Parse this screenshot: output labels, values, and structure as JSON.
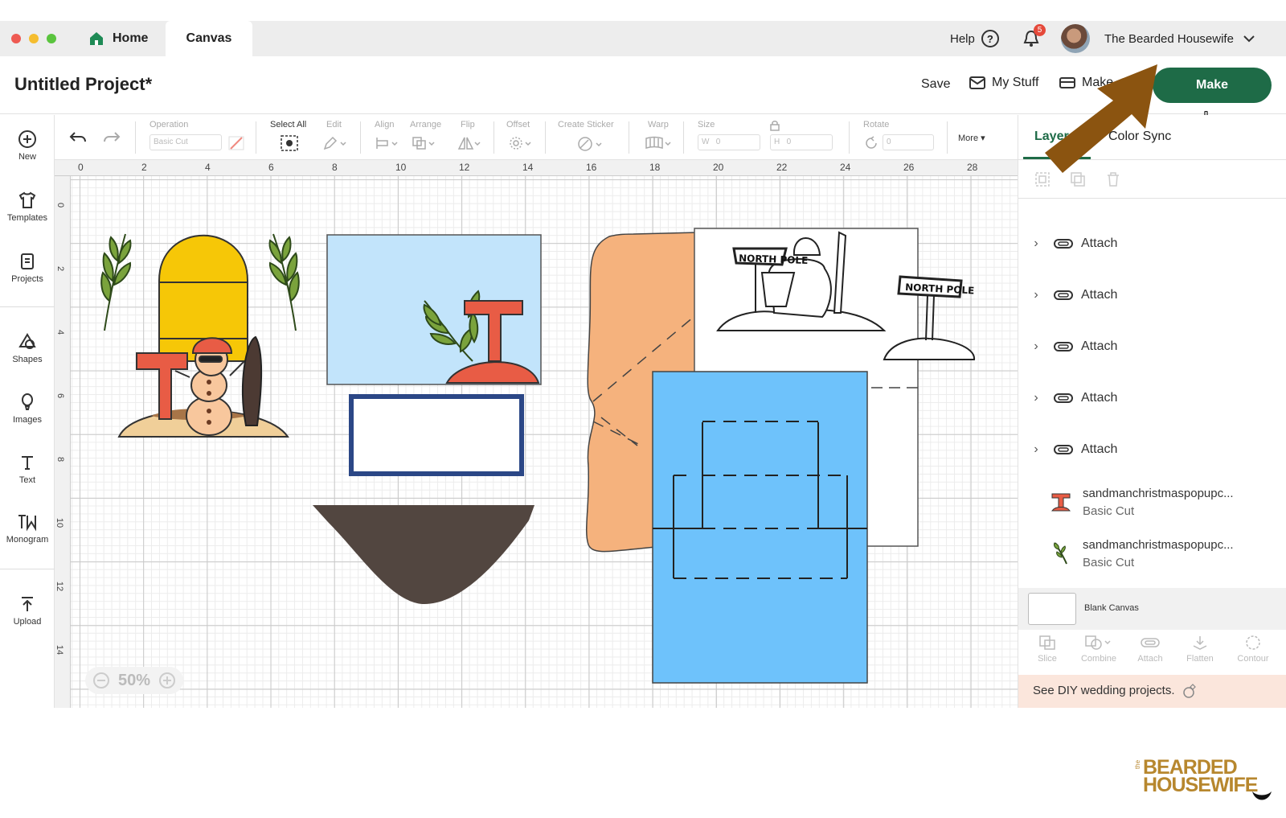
{
  "titlebar": {
    "tabs": {
      "home": "Home",
      "canvas": "Canvas"
    },
    "help": "Help",
    "help_glyph": "?",
    "notifications": "5",
    "user_name": "The Bearded Housewife"
  },
  "header": {
    "project_title": "Untitled Project*",
    "save": "Save",
    "my_stuff": "My Stuff",
    "machine": "Make...",
    "make": "Make"
  },
  "sidebar": {
    "new": "New",
    "templates": "Templates",
    "projects": "Projects",
    "shapes": "Shapes",
    "images": "Images",
    "text": "Text",
    "monogram": "Monogram",
    "upload": "Upload"
  },
  "toolbar": {
    "operation": "Operation",
    "operation_value": "Basic Cut",
    "select_all": "Select All",
    "edit": "Edit",
    "align": "Align",
    "arrange": "Arrange",
    "flip": "Flip",
    "offset": "Offset",
    "create_sticker": "Create Sticker",
    "warp": "Warp",
    "size": "Size",
    "w": "W",
    "w_value": "0",
    "h": "H",
    "h_value": "0",
    "rotate": "Rotate",
    "rotate_value": "0",
    "more": "More ▾"
  },
  "rulers": {
    "top": [
      "0",
      "2",
      "4",
      "6",
      "8",
      "10",
      "12",
      "14",
      "16",
      "18",
      "20",
      "22",
      "24",
      "26",
      "28"
    ],
    "left": [
      "0",
      "2",
      "4",
      "6",
      "8",
      "10",
      "12",
      "14"
    ]
  },
  "canvas": {
    "zoom": "50%",
    "sign_text": "NORTH POLE"
  },
  "panel": {
    "tabs": {
      "layers": "Layers",
      "color_sync": "Color Sync"
    },
    "layers": [
      {
        "label": "Attach"
      },
      {
        "label": "Attach"
      },
      {
        "label": "Attach"
      },
      {
        "label": "Attach"
      },
      {
        "label": "Attach"
      }
    ],
    "image_layers": [
      {
        "name": "sandmanchristmaspopupc...",
        "operation": "Basic Cut"
      },
      {
        "name": "sandmanchristmaspopupc...",
        "operation": "Basic Cut"
      }
    ],
    "blank_canvas": "Blank Canvas",
    "tools": {
      "slice": "Slice",
      "combine": "Combine",
      "attach": "Attach",
      "flatten": "Flatten",
      "contour": "Contour"
    },
    "promo": "See DIY wedding projects."
  },
  "watermark": {
    "line1": "BEARDED",
    "line2": "HOUSEWIFE",
    "small": "the"
  },
  "colors": {
    "make": "#1e6b47",
    "arrow": "#8b5410",
    "blue_card": "#6ec2fb",
    "light_blue": "#c2e4fb",
    "orange": "#f5b27d",
    "dark_brown": "#524640"
  }
}
